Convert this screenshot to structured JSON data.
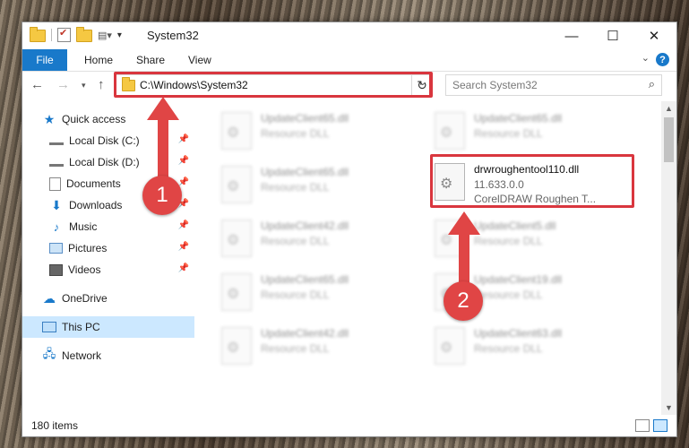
{
  "window": {
    "title": "System32",
    "controls": {
      "minimize": "—",
      "maximize": "☐",
      "close": "✕"
    }
  },
  "ribbon": {
    "file_tab": "File",
    "tabs": [
      "Home",
      "Share",
      "View"
    ]
  },
  "navigation": {
    "address": "C:\\Windows\\System32",
    "search_placeholder": "Search System32"
  },
  "sidebar": {
    "items": [
      {
        "label": "Quick access",
        "icon": "star-icon",
        "pinned": false
      },
      {
        "label": "Local Disk (C:)",
        "icon": "drive-icon",
        "pinned": true
      },
      {
        "label": "Local Disk (D:)",
        "icon": "drive-icon",
        "pinned": true
      },
      {
        "label": "Documents",
        "icon": "documents-icon",
        "pinned": true
      },
      {
        "label": "Downloads",
        "icon": "download-icon",
        "pinned": true
      },
      {
        "label": "Music",
        "icon": "music-icon",
        "pinned": true
      },
      {
        "label": "Pictures",
        "icon": "pictures-icon",
        "pinned": true
      },
      {
        "label": "Videos",
        "icon": "videos-icon",
        "pinned": true
      },
      {
        "label": "OneDrive",
        "icon": "cloud-icon",
        "pinned": false
      },
      {
        "label": "This PC",
        "icon": "computer-icon",
        "pinned": false,
        "selected": true
      },
      {
        "label": "Network",
        "icon": "network-icon",
        "pinned": false
      }
    ]
  },
  "files": {
    "left": [
      {
        "name": "UpdateClient65.dll",
        "type": "Resource DLL"
      },
      {
        "name": "UpdateClient65.dll",
        "type": "Resource DLL"
      },
      {
        "name": "UpdateClient42.dll",
        "type": "Resource DLL"
      },
      {
        "name": "UpdateClient65.dll",
        "type": "Resource DLL"
      },
      {
        "name": "UpdateClient42.dll",
        "type": "Resource DLL"
      }
    ],
    "right": [
      {
        "name": "UpdateClient65.dll",
        "type": "Resource DLL"
      },
      {
        "name": "UpdateClient5.dll",
        "type": "Resource DLL"
      },
      {
        "name": "UpdateClient19.dll",
        "type": "Resource DLL"
      },
      {
        "name": "UpdateClient63.dll",
        "type": "Resource DLL"
      }
    ],
    "highlighted": {
      "name": "drwroughentool110.dll",
      "version": "11.633.0.0",
      "description": "CorelDRAW Roughen T..."
    }
  },
  "status": {
    "item_count": "180 items"
  },
  "annotations": {
    "marker1": "1",
    "marker2": "2",
    "color": "#e04545"
  }
}
